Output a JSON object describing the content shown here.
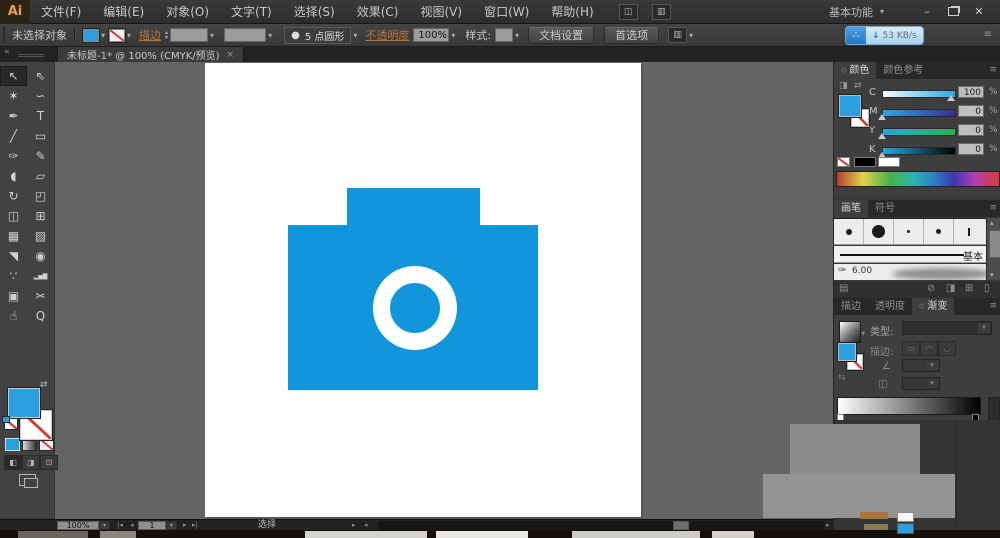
{
  "window": {
    "logo": "Ai",
    "workspace_switcher": "基本功能"
  },
  "menubar": {
    "items": [
      {
        "label": "文件(F)"
      },
      {
        "label": "编辑(E)"
      },
      {
        "label": "对象(O)"
      },
      {
        "label": "文字(T)"
      },
      {
        "label": "选择(S)"
      },
      {
        "label": "效果(C)"
      },
      {
        "label": "视图(V)"
      },
      {
        "label": "窗口(W)"
      },
      {
        "label": "帮助(H)"
      }
    ]
  },
  "controlbar": {
    "selection_status": "未选择对象",
    "stroke_link": "描边",
    "brush_preset": "5 点圆形",
    "opacity_link": "不透明度",
    "opacity_value": "100%",
    "style_label": "样式:",
    "document_setup": "文档设置",
    "preferences": "首选项",
    "download_speed": "53 KB/s"
  },
  "tabbar": {
    "document_title": "未标题-1* @ 100% (CMYK/预览)"
  },
  "toolbar": {
    "tools": [
      {
        "name": "selection-tool",
        "glyph": "↖"
      },
      {
        "name": "direct-selection-tool",
        "glyph": "⇖"
      },
      {
        "name": "magic-wand-tool",
        "glyph": "✶"
      },
      {
        "name": "lasso-tool",
        "glyph": "∽"
      },
      {
        "name": "pen-tool",
        "glyph": "✒"
      },
      {
        "name": "type-tool",
        "glyph": "T"
      },
      {
        "name": "line-segment-tool",
        "glyph": "╱"
      },
      {
        "name": "rectangle-tool",
        "glyph": "▭"
      },
      {
        "name": "paintbrush-tool",
        "glyph": "✑"
      },
      {
        "name": "pencil-tool",
        "glyph": "✎"
      },
      {
        "name": "blob-brush-tool",
        "glyph": "◖"
      },
      {
        "name": "eraser-tool",
        "glyph": "▱"
      },
      {
        "name": "rotate-tool",
        "glyph": "↻"
      },
      {
        "name": "free-transform-tool",
        "glyph": "◰"
      },
      {
        "name": "shape-builder-tool",
        "glyph": "◫"
      },
      {
        "name": "perspective-grid-tool",
        "glyph": "⊞"
      },
      {
        "name": "mesh-tool",
        "glyph": "▦"
      },
      {
        "name": "gradient-tool",
        "glyph": "▨"
      },
      {
        "name": "eyedropper-tool",
        "glyph": "◥"
      },
      {
        "name": "blend-tool",
        "glyph": "◉"
      },
      {
        "name": "symbol-sprayer-tool",
        "glyph": "∵"
      },
      {
        "name": "column-graph-tool",
        "glyph": "▂▅▇"
      },
      {
        "name": "artboard-tool",
        "glyph": "▣"
      },
      {
        "name": "slice-tool",
        "glyph": "✂"
      },
      {
        "name": "hand-tool",
        "glyph": "☝"
      },
      {
        "name": "zoom-tool",
        "glyph": "Q"
      }
    ]
  },
  "panels": {
    "color": {
      "tab_color": "颜色",
      "tab_color_guide": "颜色参考",
      "percent": "%",
      "channels": [
        {
          "label": "C",
          "value": "100"
        },
        {
          "label": "M",
          "value": "0"
        },
        {
          "label": "Y",
          "value": "0"
        },
        {
          "label": "K",
          "value": "0"
        }
      ]
    },
    "brushes": {
      "tab_brushes": "画笔",
      "tab_symbols": "符号",
      "basic_brush": "基本",
      "calligraphic_size": "6.00"
    },
    "gradient": {
      "tab_stroke": "描边",
      "tab_transparency": "透明度",
      "tab_gradient": "渐变",
      "type_label": "类型:",
      "stroke_label": "描边:"
    }
  },
  "statusbar": {
    "zoom_level": "100%",
    "artboard_number": "1",
    "current_tool": "选择"
  },
  "icons": {
    "dropdown": "▾",
    "up": "▴",
    "panel_menu": "≡",
    "close": "✕",
    "tab_close": "×",
    "collapse_left": "«",
    "minimize": "–",
    "down_arrow": "↓",
    "bullet": "●",
    "logo_cluster": "∴",
    "angle": "∠",
    "nav_first": "|◂",
    "nav_prev": "◂",
    "nav_next": "▸",
    "nav_last": "▸|",
    "scroll_right": "▸",
    "scroll_left": "◂",
    "swap": "⇄",
    "reverse": "⇆",
    "bridge": "◫",
    "arrange": "▥",
    "panel_diamond": "◇",
    "brush_library": "▤",
    "remove_brush": "⊘",
    "brush_options": "◨",
    "new_brush": "⊞",
    "delete_brush": "▯",
    "grad_btn1": "▭",
    "grad_btn2": "◠",
    "grad_btn3": "◡",
    "mode_normal": "◧",
    "mode_behind": "◨",
    "mode_inside": "⊡",
    "nib": "✑"
  },
  "colors": {
    "accent_blue": "#1296db",
    "camera_blue": "#1296db",
    "pasteboard_gray": "#646464",
    "artboard_white": "#ffffff",
    "cyan_value_full": "#28a9e1"
  }
}
